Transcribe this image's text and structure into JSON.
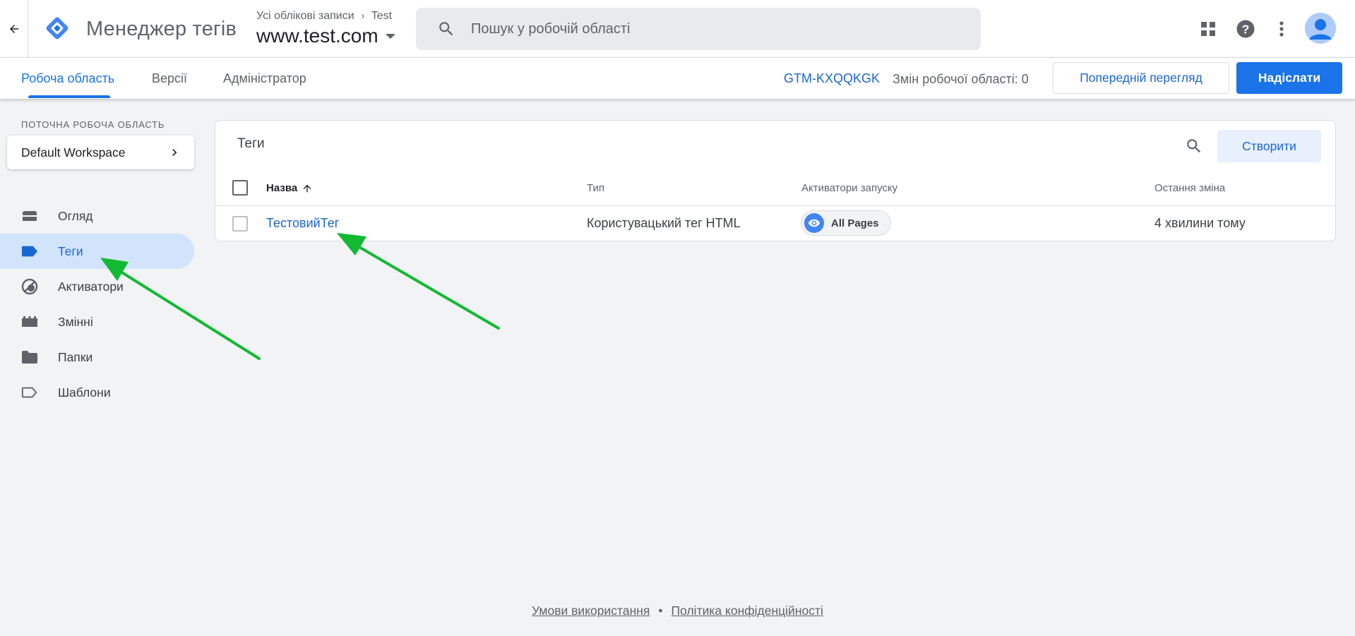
{
  "header": {
    "app_title": "Менеджер тегів",
    "breadcrumb_accounts": "Усі облікові записи",
    "breadcrumb_account": "Test",
    "container_name": "www.test.com",
    "search_placeholder": "Пошук у робочій області",
    "icons": [
      "back-arrow-icon",
      "gtm-logo-icon",
      "chevron-right-icon",
      "dropdown-icon",
      "search-icon",
      "apps-grid-icon",
      "help-icon",
      "more-vert-icon",
      "avatar-icon"
    ]
  },
  "nav": {
    "tabs": [
      {
        "label": "Робоча область",
        "active": true
      },
      {
        "label": "Версії",
        "active": false
      },
      {
        "label": "Адміністратор",
        "active": false
      }
    ],
    "container_id": "GTM-KXQQKGK",
    "workspace_changes": "Змін робочої області: 0",
    "preview_label": "Попередній перегляд",
    "submit_label": "Надіслати"
  },
  "sidebar": {
    "workspace_label": "ПОТОЧНА РОБОЧА ОБЛАСТЬ",
    "workspace_name": "Default Workspace",
    "items": [
      {
        "label": "Огляд",
        "icon": "overview-icon",
        "active": false
      },
      {
        "label": "Теги",
        "icon": "tag-icon",
        "active": true
      },
      {
        "label": "Активатори",
        "icon": "trigger-icon",
        "active": false
      },
      {
        "label": "Змінні",
        "icon": "variables-icon",
        "active": false
      },
      {
        "label": "Папки",
        "icon": "folder-icon",
        "active": false
      },
      {
        "label": "Шаблони",
        "icon": "template-icon",
        "active": false
      }
    ]
  },
  "tags_table": {
    "title": "Теги",
    "create_label": "Створити",
    "columns": {
      "name": "Назва",
      "type": "Тип",
      "triggers": "Активатори запуску",
      "last_edited": "Остання зміна"
    },
    "rows": [
      {
        "name": "ТестовийТег",
        "type": "Користувацький тег HTML",
        "trigger": "All Pages",
        "last_edited": "4 хвилини тому"
      }
    ]
  },
  "footer": {
    "terms": "Умови використання",
    "separator": "•",
    "privacy": "Політика конфіденційності"
  },
  "colors": {
    "accent": "#1a73e8",
    "link": "#1967d2",
    "active_nav_bg": "#d2e3fc",
    "annotation_arrow": "#12b933",
    "background": "#f1f3f4"
  }
}
